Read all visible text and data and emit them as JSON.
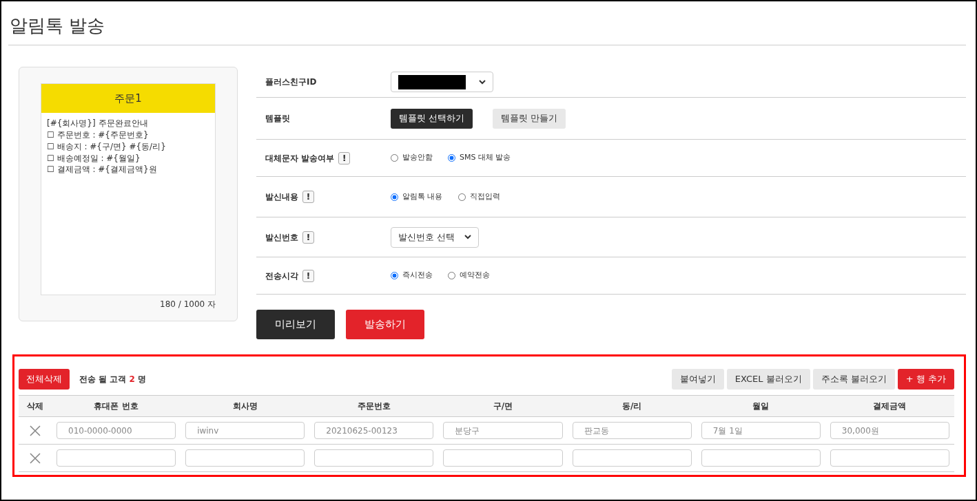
{
  "page_title": "알림톡 발송",
  "preview": {
    "header": "주문1",
    "lines": [
      "[#{회사명}] 주문완료안내",
      "☐ 주문번호 : #{주문번호}",
      "☐ 배송지 : #{구/면} #{동/리}",
      "☐ 배송예정일 : #{월일}",
      "☐ 결제금액 : #{결제금액}원"
    ],
    "counter": "180 / 1000 자"
  },
  "form": [
    {
      "kind": "select",
      "label": "플러스친구ID",
      "help": false,
      "redacted": true
    },
    {
      "kind": "buttons",
      "label": "템플릿",
      "help": false,
      "buttons": [
        {
          "label": "템플릿 선택하기"
        },
        {
          "label": "템플릿 만들기"
        }
      ]
    },
    {
      "kind": "radio",
      "label": "대체문자 발송여부",
      "help": true,
      "options": [
        {
          "label": "발송안함",
          "selected": false
        },
        {
          "label": "SMS 대체 발송",
          "selected": true
        }
      ]
    },
    {
      "kind": "radio",
      "label": "발신내용",
      "help": true,
      "options": [
        {
          "label": "알림톡 내용",
          "selected": true
        },
        {
          "label": "직접입력",
          "selected": false
        }
      ]
    },
    {
      "kind": "select",
      "label": "발신번호",
      "help": true,
      "value": "발신번호 선택"
    },
    {
      "kind": "radio",
      "label": "전송시각",
      "help": true,
      "options": [
        {
          "label": "즉시전송",
          "selected": true
        },
        {
          "label": "예약전송",
          "selected": false
        }
      ]
    }
  ],
  "help_mark": "!",
  "actions": [
    {
      "label": "미리보기"
    },
    {
      "label": "발송하기"
    }
  ],
  "recipients": {
    "delete_all": "전체삭제",
    "count_before": "전송 될 고객",
    "count": "2",
    "count_after": "명",
    "tools": [
      {
        "label": "붙여넣기"
      },
      {
        "label": "EXCEL 불러오기"
      },
      {
        "label": "주소록 불러오기"
      },
      {
        "label": "+ 행 추가"
      }
    ],
    "columns": [
      "삭제",
      "휴대폰 번호",
      "회사명",
      "주문번호",
      "구/면",
      "동/리",
      "월일",
      "결제금액"
    ],
    "rows": [
      {
        "cells": [
          {
            "kind": "delete"
          },
          {
            "kind": "input",
            "placeholder": "010-0000-0000"
          },
          {
            "kind": "input",
            "placeholder": "iwinv"
          },
          {
            "kind": "input",
            "placeholder": "20210625-00123"
          },
          {
            "kind": "input",
            "placeholder": "분당구"
          },
          {
            "kind": "input",
            "placeholder": "판교동"
          },
          {
            "kind": "input",
            "placeholder": "7월 1일"
          },
          {
            "kind": "input",
            "placeholder": "30,000원"
          }
        ]
      },
      {
        "cells": [
          {
            "kind": "delete"
          },
          {
            "kind": "input"
          },
          {
            "kind": "input"
          },
          {
            "kind": "input"
          },
          {
            "kind": "input"
          },
          {
            "kind": "input"
          },
          {
            "kind": "input"
          },
          {
            "kind": "input"
          }
        ]
      }
    ]
  }
}
